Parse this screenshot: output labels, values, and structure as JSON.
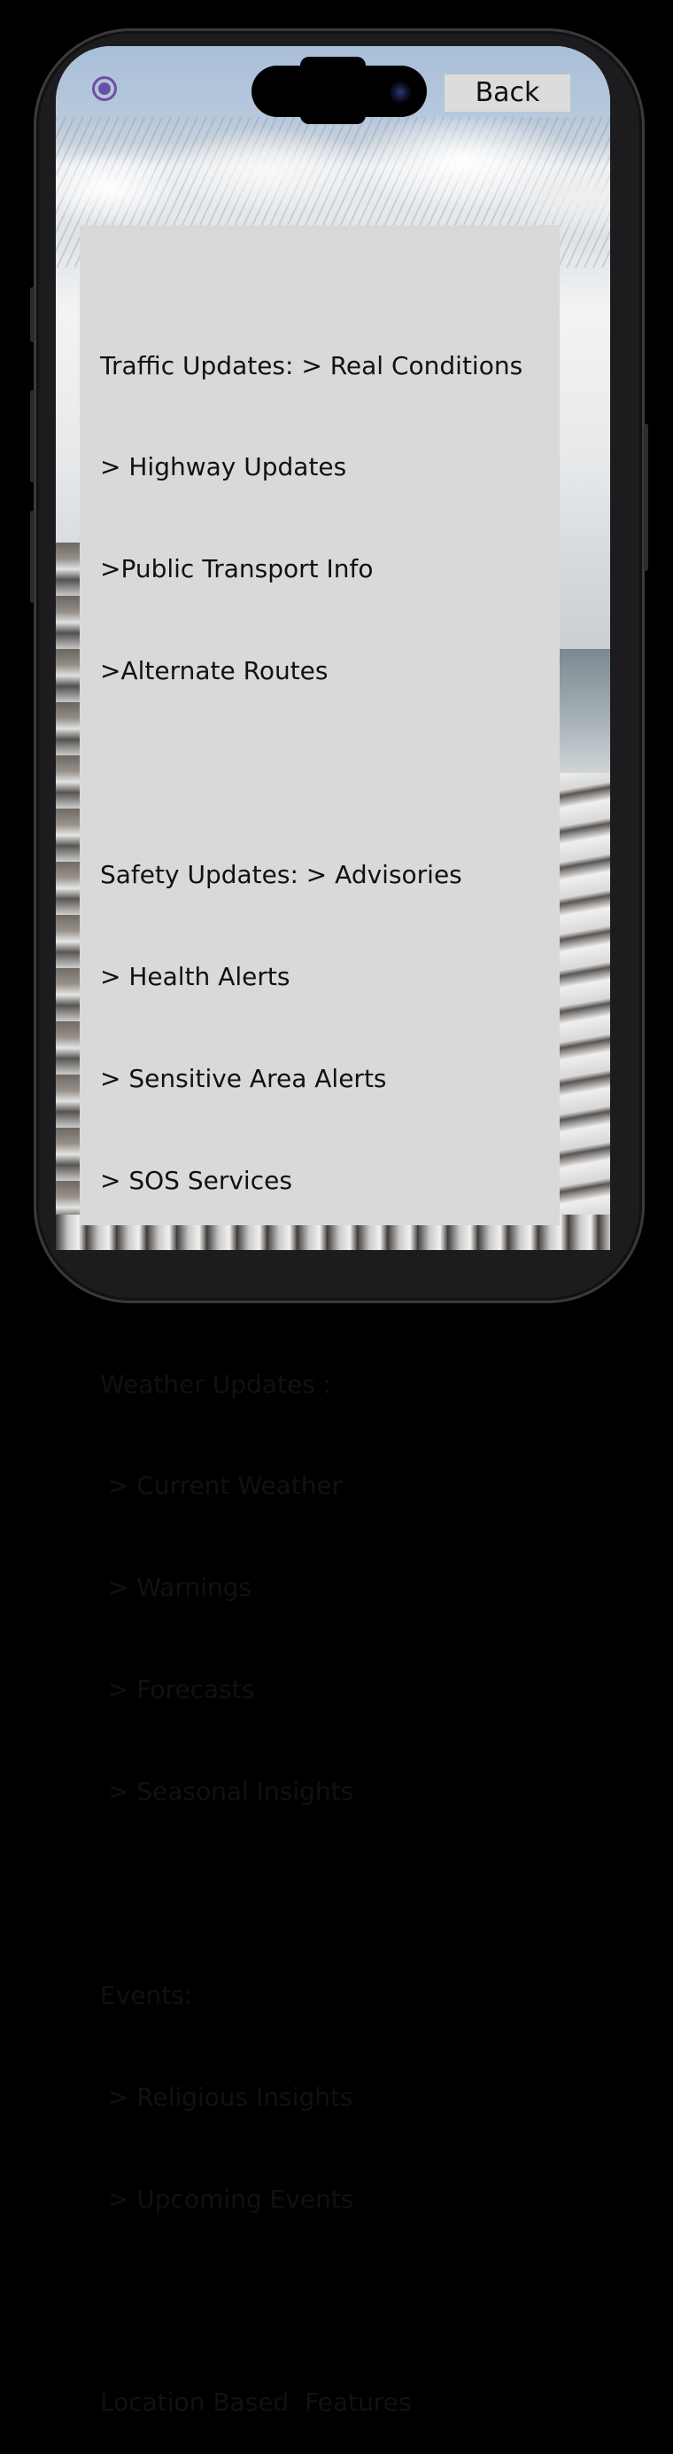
{
  "header": {
    "back_label": "Back"
  },
  "menu": {
    "lines": [
      "Traffic Updates: > Real Conditions",
      "> Highway Updates",
      ">Public Transport Info",
      ">Alternate Routes",
      "",
      "Safety Updates: > Advisories",
      "> Health Alerts",
      "> Sensitive Area Alerts",
      "> SOS Services",
      "",
      "Weather Updates :",
      " > Current Weather",
      " > Warnings",
      " > Forecasts",
      " > Seasonal Insights",
      "",
      "Events:",
      " > Religious Insights",
      " > Upcoming Events",
      "",
      "Location Based  Features"
    ]
  },
  "icons": {
    "status": "radio-button-icon"
  },
  "colors": {
    "panel": "#d9d9d9",
    "back_button": "#dcdcdc",
    "radio_icon": "#6b4ea8"
  }
}
